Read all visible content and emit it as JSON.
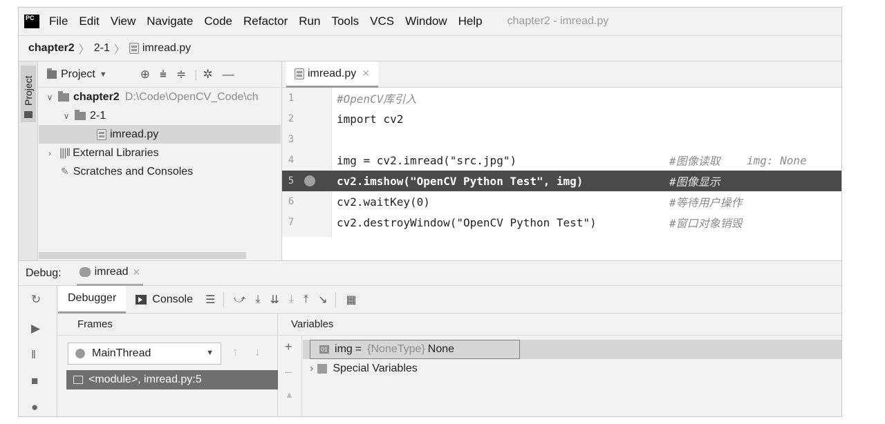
{
  "app": {
    "logo_text": "PC",
    "title": "chapter2 - imread.py"
  },
  "menu": [
    "File",
    "Edit",
    "View",
    "Navigate",
    "Code",
    "Refactor",
    "Run",
    "Tools",
    "VCS",
    "Window",
    "Help"
  ],
  "breadcrumb": [
    "chapter2",
    "2-1",
    "imread.py"
  ],
  "side_strip": {
    "project_tab": "Project"
  },
  "project_panel": {
    "title": "Project",
    "tree": {
      "root_name": "chapter2",
      "root_path": "D:\\Code\\OpenCV_Code\\ch",
      "folder": "2-1",
      "file": "imread.py",
      "external": "External Libraries",
      "scratches": "Scratches and Consoles"
    }
  },
  "editor": {
    "tab": "imread.py",
    "lines": [
      {
        "num": "1",
        "code": "#OpenCV库引入",
        "comment": "",
        "hint": ""
      },
      {
        "num": "2",
        "code": "import cv2",
        "comment": "",
        "hint": ""
      },
      {
        "num": "3",
        "code": "",
        "comment": "",
        "hint": ""
      },
      {
        "num": "4",
        "code": "img = cv2.imread(\"src.jpg\")",
        "comment": "#图像读取",
        "hint": "img: None"
      },
      {
        "num": "5",
        "code": "cv2.imshow(\"OpenCV Python Test\", img)",
        "comment": "#图像显示",
        "hint": ""
      },
      {
        "num": "6",
        "code": "cv2.waitKey(0)",
        "comment": "#等待用户操作",
        "hint": ""
      },
      {
        "num": "7",
        "code": "cv2.destroyWindow(\"OpenCV Python Test\")",
        "comment": "#窗口对象销毁",
        "hint": ""
      }
    ]
  },
  "debug": {
    "label": "Debug:",
    "session_tab": "imread",
    "tabs": {
      "debugger": "Debugger",
      "console": "Console"
    },
    "frames": {
      "header": "Frames",
      "thread": "MainThread",
      "frame_item": "<module>, imread.py:5"
    },
    "variables": {
      "header": "Variables",
      "badge": "01",
      "var_name": "img",
      "var_eq": "=",
      "var_type": "{NoneType}",
      "var_value": "None",
      "special": "Special Variables"
    }
  }
}
